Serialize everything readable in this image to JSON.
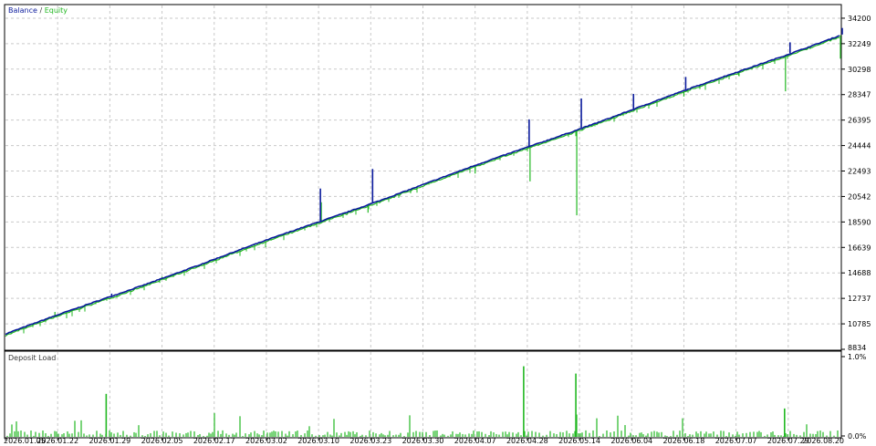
{
  "chart_data": [
    {
      "type": "line",
      "title": "",
      "legend": {
        "placement": "top-left",
        "items": [
          {
            "label": "Balance",
            "color": "#0a1a9c"
          },
          {
            "label": " / ",
            "color": "#3a3a3a"
          },
          {
            "label": "Equity",
            "color": "#22b822"
          }
        ]
      },
      "ylim": [
        8834,
        35175
      ],
      "y_ticks": [
        "34200",
        "32249",
        "30298",
        "28347",
        "26395",
        "24444",
        "22493",
        "20542",
        "18590",
        "16639",
        "14688",
        "12737",
        "10785",
        "8834"
      ],
      "x_ticks": [
        "2026.01.05",
        "2026.01.22",
        "2026.01.29",
        "2026.02.05",
        "2026.02.17",
        "2026.03.02",
        "2026.03.10",
        "2026.03.23",
        "2026.03.30",
        "2026.04.07",
        "2026.04.28",
        "2026.05.14",
        "2026.06.04",
        "2026.06.18",
        "2026.07.07",
        "2026.07.29",
        "2026.08.20"
      ],
      "grid": true,
      "series": [
        {
          "name": "Balance",
          "color": "#0a1a9c",
          "start": 10000,
          "end": 32900
        },
        {
          "name": "Equity",
          "color": "#22b822"
        }
      ],
      "balance_spikes": [
        {
          "date": "2026.01.29",
          "value": 13100
        },
        {
          "date": "2026.03.10",
          "value": 21150
        },
        {
          "date": "2026.03.23",
          "value": 22650
        },
        {
          "date": "2026.04.28",
          "value": 26450
        },
        {
          "date": "2026.05.14",
          "value": 28050
        },
        {
          "date": "2026.06.04",
          "value": 28400
        },
        {
          "date": "2026.06.18",
          "value": 29700
        },
        {
          "date": "2026.07.29",
          "value": 32350
        },
        {
          "date": "2026.08.20",
          "value": 33450
        }
      ],
      "equity_drawdowns": [
        {
          "date": "2026.01.22",
          "value": 11700
        },
        {
          "date": "2026.02.05",
          "value": 14400
        },
        {
          "date": "2026.03.10",
          "value": 20100
        },
        {
          "date": "2026.03.23",
          "value": 19300
        },
        {
          "date": "2026.04.07",
          "value": 22300
        },
        {
          "date": "2026.04.28",
          "value": 21700
        },
        {
          "date": "2026.05.14",
          "value": 19100
        },
        {
          "date": "2026.06.18",
          "value": 28200
        },
        {
          "date": "2026.07.07",
          "value": 29800
        },
        {
          "date": "2026.07.29",
          "value": 28600
        },
        {
          "date": "2026.08.20",
          "value": 31100
        }
      ]
    },
    {
      "type": "bar",
      "title": "Deposit Load",
      "title_color": "#3a3a3a",
      "color": "#22b822",
      "ylim": [
        0,
        1
      ],
      "y_ticks": [
        "1.0%",
        "0.0%"
      ],
      "peaks": [
        {
          "date": "2026.01.29",
          "value": 0.53
        },
        {
          "date": "2026.04.28",
          "value": 0.87
        },
        {
          "date": "2026.05.14",
          "value": 0.78
        },
        {
          "date": "2026.07.29",
          "value": 0.35
        }
      ]
    }
  ]
}
